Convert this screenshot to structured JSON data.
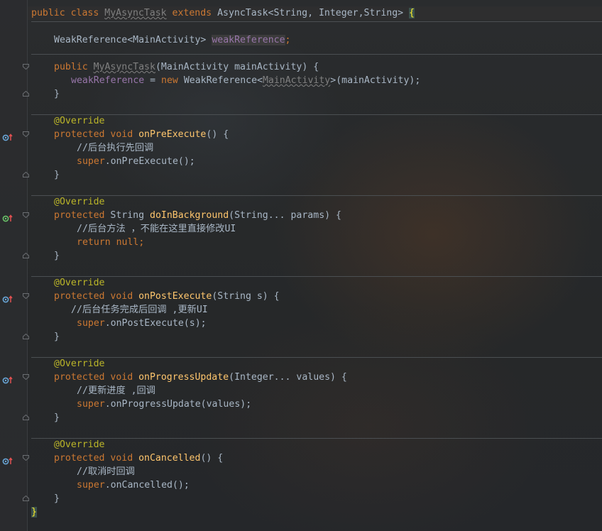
{
  "editor": {
    "colors": {
      "keyword": "#cc7832",
      "annotation": "#bbb529",
      "method": "#ffc66d",
      "field": "#9876aa",
      "text": "#a9b7c6",
      "background": "#2b2b2b"
    },
    "code": {
      "class_decl": {
        "kw1": "public",
        "kw2": "class",
        "name": "MyAsyncTask",
        "kw3": "extends",
        "rest": "AsyncTask<String, Integer,String> ",
        "brace": "{"
      },
      "field_decl": {
        "type": "WeakReference<MainActivity> ",
        "name": "weakReference",
        "semi": ";"
      },
      "ctor_sig": {
        "kw": "public",
        "name": "MyAsyncTask",
        "params": "(MainActivity mainActivity) {"
      },
      "ctor_body": {
        "field": "weakReference",
        "eq": " = ",
        "kw": "new",
        "type": " WeakReference<",
        "generic": "MainActivity",
        "rest": ">(mainActivity);"
      },
      "close_inner": "}",
      "override": "@Override",
      "m1": {
        "kw": "protected void ",
        "name": "onPreExecute",
        "params": "() {",
        "comment": "//后台执行先回调",
        "call_kw": "super",
        "call": ".onPreExecute();"
      },
      "m2": {
        "kw": "protected",
        "type": " String ",
        "name": "doInBackground",
        "params": "(String... params) {",
        "comment": "//后台方法 ，不能在这里直接修改UI",
        "ret_kw": "return",
        "ret_val": "null",
        "semi": ";"
      },
      "m3": {
        "kw": "protected void ",
        "name": "onPostExecute",
        "params": "(String s) {",
        "comment": "//后台任务完成后回调 ,更新UI",
        "call_kw": "super",
        "call": ".onPostExecute(s);"
      },
      "m4": {
        "kw": "protected void ",
        "name": "onProgressUpdate",
        "params": "(Integer... values) {",
        "comment": "//更新进度 ,回调",
        "call_kw": "super",
        "call": ".onProgressUpdate(values);"
      },
      "m5": {
        "kw": "protected void ",
        "name": "onCancelled",
        "params": "() {",
        "comment": "//取消时回调",
        "call_kw": "super",
        "call": ".onCancelled();"
      },
      "class_close": "}"
    },
    "gutter_icons": {
      "override": "override-method-icon",
      "implement": "implement-method-icon",
      "fold": "fold-marker-icon"
    }
  }
}
